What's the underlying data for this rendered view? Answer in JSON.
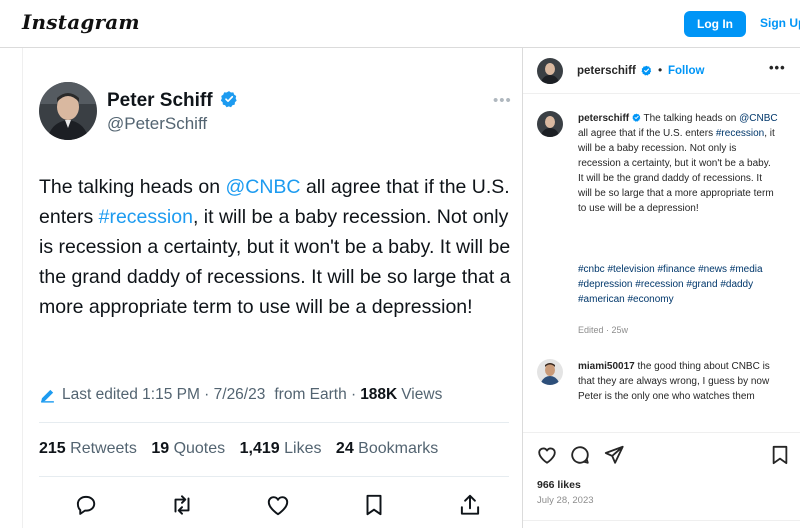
{
  "header": {
    "logo": "Instagram",
    "login_label": "Log In",
    "signup_label": "Sign Up"
  },
  "tweet": {
    "name": "Peter Schiff",
    "handle": "@PeterSchiff",
    "text_parts": [
      "The talking heads on ",
      "@CNBC",
      " all agree that if the U.S. enters ",
      "#recession",
      ", it will be a baby recession. Not only is recession a certainty, but it won't be a baby. It will be the grand daddy of recessions. It will be so large that a more appropriate term to use will be a depression!"
    ],
    "meta": {
      "edited": "Last edited 1:15 PM · 7/26/23",
      "source": "from Earth ·",
      "views_count": "188K",
      "views_label": "Views"
    },
    "stats": [
      {
        "count": "215",
        "label": "Retweets"
      },
      {
        "count": "19",
        "label": "Quotes"
      },
      {
        "count": "1,419",
        "label": "Likes"
      },
      {
        "count": "24",
        "label": "Bookmarks"
      }
    ]
  },
  "post": {
    "username": "peterschiff",
    "follow_label": "Follow",
    "dot": "•",
    "caption_parts": [
      "The talking heads on ",
      "@CNBC",
      " all agree that if the U.S. enters ",
      "#recession",
      ", it will be a baby recession. Not only is recession a certainty, but it won't be a baby. It will be the grand daddy of recessions. It will be so large that a more appropriate term to use will be a depression!"
    ],
    "hashtags": "#cnbc #television #finance #news #media #depression #recession #grand #daddy #american #economy",
    "edited": "Edited · 25w",
    "comment": {
      "username": "miami50017",
      "text": "the good thing about CNBC is that they are always wrong, I guess by now Peter is the only one who watches them"
    },
    "likes": "966 likes",
    "date": "July 28, 2023"
  },
  "icons": {
    "verified": "verified-badge-icon",
    "edit": "pencil-icon",
    "reply": "reply-icon",
    "retweet": "retweet-icon",
    "like": "heart-icon",
    "bookmark": "bookmark-icon",
    "share": "share-icon",
    "comment": "comment-icon",
    "send": "send-icon",
    "save": "save-icon"
  },
  "colors": {
    "instagram_blue": "#0095f6",
    "twitter_blue": "#1d9bf0",
    "link_dark": "#00376b"
  }
}
